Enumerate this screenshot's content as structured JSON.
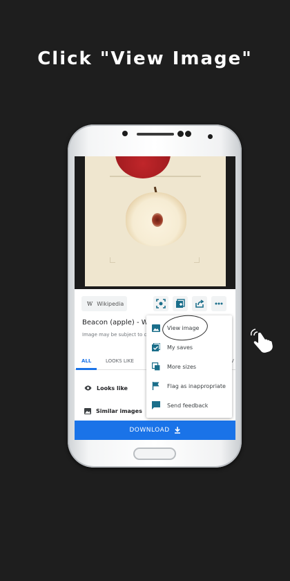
{
  "headline": "Click \"View Image\"",
  "source": {
    "logo_letter": "W",
    "name": "Wikipedia"
  },
  "result": {
    "title": "Beacon (apple) - Wik",
    "subtitle": "Image may be subject to co"
  },
  "tabs": [
    {
      "label": "ALL",
      "active": true
    },
    {
      "label": "LOOKS LIKE",
      "active": false
    },
    {
      "label": "V",
      "active": false
    }
  ],
  "cards": [
    {
      "label": "Looks like",
      "icon": "eye-icon"
    },
    {
      "label": "Similar images",
      "icon": "image-icon"
    }
  ],
  "menu": {
    "items": [
      {
        "label": "View image",
        "icon": "image-icon"
      },
      {
        "label": "My saves",
        "icon": "bookmark-check-icon"
      },
      {
        "label": "More sizes",
        "icon": "layers-icon"
      },
      {
        "label": "Flag as inappropriate",
        "icon": "flag-icon"
      },
      {
        "label": "Send feedback",
        "icon": "feedback-icon"
      }
    ]
  },
  "download_label": "DOWNLOAD",
  "colors": {
    "accent": "#1a73e8",
    "icon_teal": "#1a6e8a",
    "background": "#1e1e1e"
  }
}
